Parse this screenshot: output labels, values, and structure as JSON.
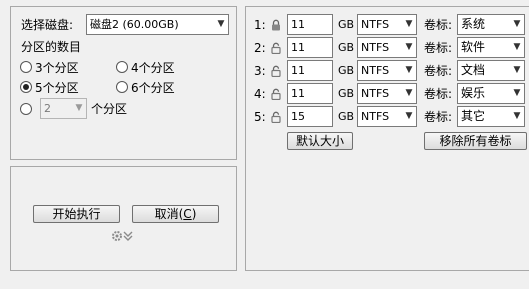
{
  "disk": {
    "label": "选择磁盘:",
    "selected": "磁盘2 (60.00GB)"
  },
  "partition_count": {
    "label": "分区的数目",
    "options": [
      "3个分区",
      "4个分区",
      "5个分区",
      "6个分区"
    ],
    "selected_index": 2,
    "custom_value": "2",
    "custom_suffix": "个分区"
  },
  "actions": {
    "start": "开始执行",
    "cancel_prefix": "取消(",
    "cancel_accel": "C",
    "cancel_suffix": ")"
  },
  "partitions": [
    {
      "index": "1:",
      "locked": true,
      "size": "11",
      "unit": "GB",
      "fs": "NTFS",
      "label_caption": "卷标:",
      "volume": "系统"
    },
    {
      "index": "2:",
      "locked": false,
      "size": "11",
      "unit": "GB",
      "fs": "NTFS",
      "label_caption": "卷标:",
      "volume": "软件"
    },
    {
      "index": "3:",
      "locked": false,
      "size": "11",
      "unit": "GB",
      "fs": "NTFS",
      "label_caption": "卷标:",
      "volume": "文档"
    },
    {
      "index": "4:",
      "locked": false,
      "size": "11",
      "unit": "GB",
      "fs": "NTFS",
      "label_caption": "卷标:",
      "volume": "娱乐"
    },
    {
      "index": "5:",
      "locked": false,
      "size": "15",
      "unit": "GB",
      "fs": "NTFS",
      "label_caption": "卷标:",
      "volume": "其它"
    }
  ],
  "buttons": {
    "default_size": "默认大小",
    "remove_labels": "移除所有卷标"
  }
}
